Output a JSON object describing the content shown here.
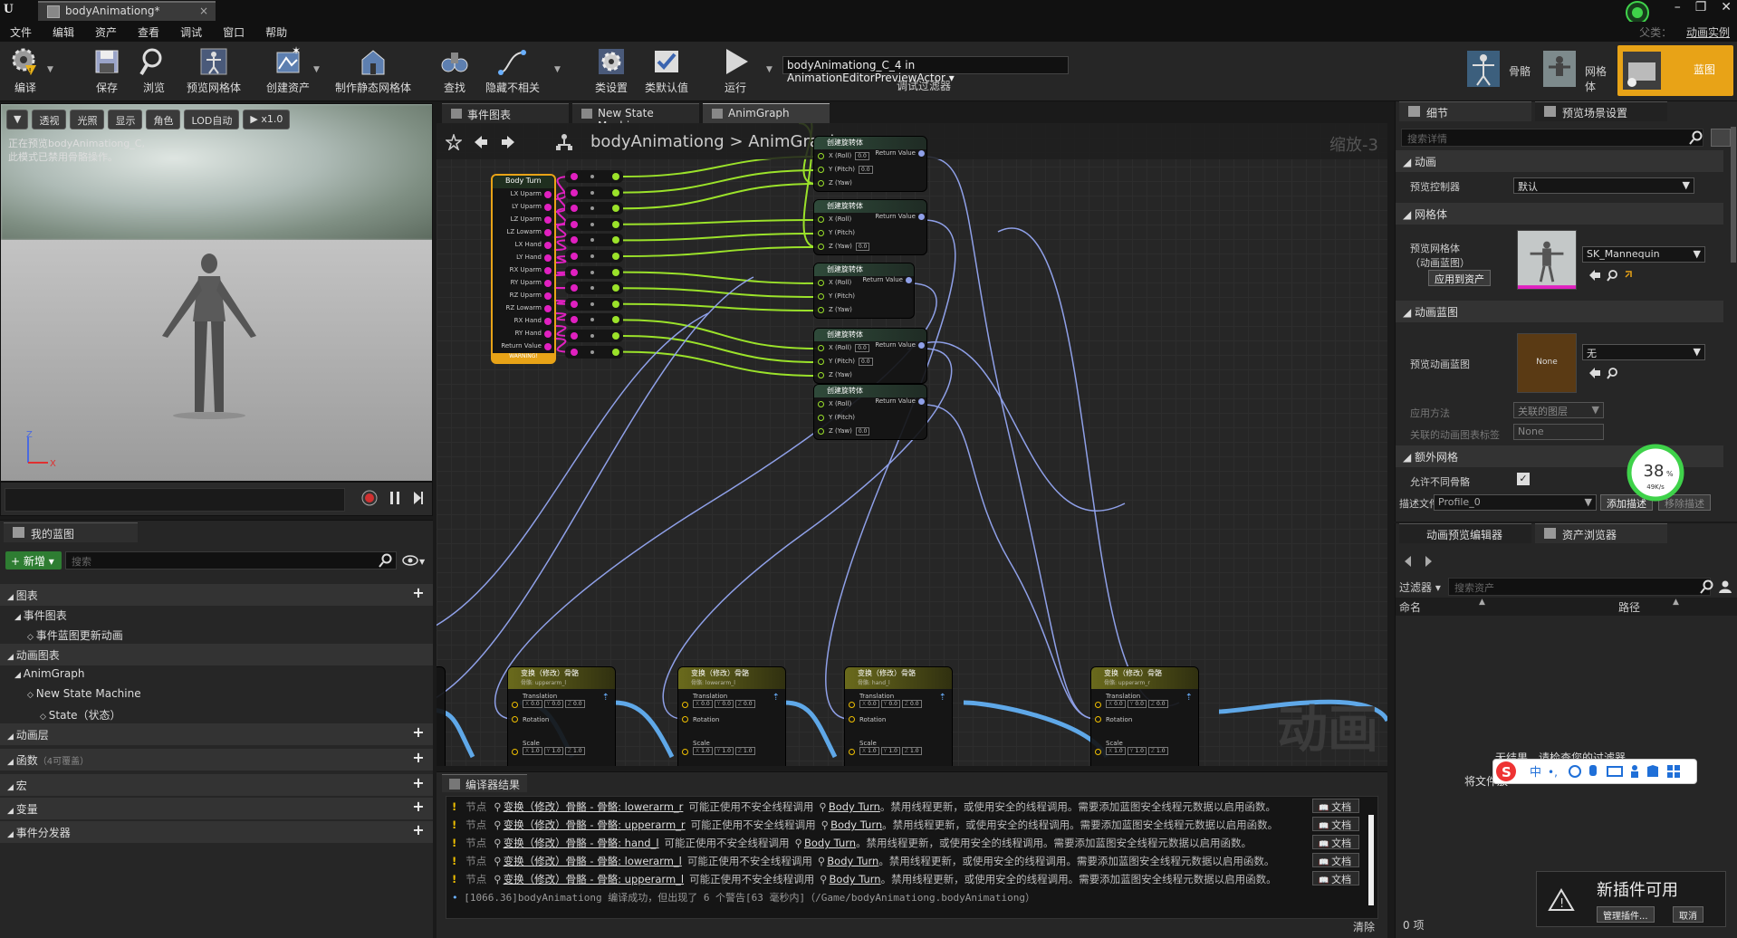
{
  "titlebar": {
    "tab_title": "bodyAnimationg*"
  },
  "menu": {
    "items": [
      "文件",
      "编辑",
      "资产",
      "查看",
      "调试",
      "窗口",
      "帮助"
    ],
    "parent_class_label": "父类：",
    "parent_class_value": "动画实例"
  },
  "toolbar": {
    "buttons": [
      "编译",
      "保存",
      "浏览",
      "预览网格体",
      "创建资产",
      "制作静态网格体",
      "查找",
      "隐藏不相关",
      "类设置",
      "类默认值",
      "运行"
    ],
    "debug_filter_value": "bodyAnimationg_C_4 in AnimationEditorPreviewActor",
    "debug_filter_label": "调试过滤器",
    "modes": [
      "骨骼",
      "网格体",
      "蓝图"
    ]
  },
  "viewport": {
    "buttons": [
      "透视",
      "光照",
      "显示",
      "角色",
      "LOD自动",
      "x1.0"
    ],
    "message_line1": "正在预览bodyAnimationg_C,",
    "message_line2": "此模式已禁用骨骼操作。"
  },
  "mybp": {
    "tab": "我的蓝图",
    "add_label": "+ 新增",
    "search_placeholder": "搜索",
    "rows": [
      {
        "label": "图表",
        "kind": "cat"
      },
      {
        "label": "事件图表",
        "kind": "item"
      },
      {
        "label": "事件蓝图更新动画",
        "kind": "item2"
      },
      {
        "label": "动画图表",
        "kind": "cat"
      },
      {
        "label": "AnimGraph",
        "kind": "item"
      },
      {
        "label": "New State Machine",
        "kind": "item2"
      },
      {
        "label": "State（状态）",
        "kind": "item3"
      },
      {
        "label": "动画层",
        "kind": "cat"
      },
      {
        "label": "函数",
        "sub": "（4可覆盖）",
        "kind": "cat"
      },
      {
        "label": "宏",
        "kind": "cat"
      },
      {
        "label": "变量",
        "kind": "cat"
      },
      {
        "label": "事件分发器",
        "kind": "cat"
      }
    ]
  },
  "graph": {
    "tabs": [
      "事件图表",
      "New State Machine",
      "AnimGraph"
    ],
    "crumb_root": "bodyAnimationg",
    "crumb_sep": ">",
    "crumb_leaf": "AnimGraph",
    "zoom": "缩放-3",
    "watermark": "动画",
    "body_turn": {
      "title": "Body Turn",
      "outputs": [
        "LX Uparm",
        "LY Uparm",
        "LZ Uparm",
        "LZ Lowarm",
        "LX Hand",
        "LY Hand",
        "RX Uparm",
        "RY Uparm",
        "RZ Uparm",
        "RZ Lowarm",
        "RX Hand",
        "RY Hand",
        "Return Value"
      ],
      "footer": "WARNING!"
    },
    "rot_title": "创建旋转体",
    "rot_pins": [
      "X (Roll)",
      "Y (Pitch)",
      "Z (Yaw)"
    ],
    "rot_return": "Return Value",
    "rot_default": "0.0",
    "bone_title": "变换（修改）骨骼",
    "bone_subs": [
      "骨骼: upperarm_l",
      "骨骼: lowerarm_l",
      "骨骼: hand_l",
      "骨骼: upperarm_r"
    ],
    "bone_pins": [
      "Translation",
      "Rotation",
      "Scale"
    ],
    "bone_axes": [
      "X",
      "Y",
      "Z"
    ],
    "bone_t": "0.0",
    "bone_s": "1.0"
  },
  "compiler": {
    "tab": "编译器结果",
    "rows": [
      {
        "lvl": "节点",
        "node": "变换（修改）骨骼 - 骨骼: lowerarm_r",
        "mid": "可能正使用不安全线程调用",
        "fn": "Body Turn",
        "tail": "。禁用线程更新，或使用安全的线程调用。需要添加蓝图安全线程元数据以启用函数。",
        "doc": "文档"
      },
      {
        "lvl": "节点",
        "node": "变换（修改）骨骼 - 骨骼: upperarm_r",
        "mid": "可能正使用不安全线程调用",
        "fn": "Body Turn",
        "tail": "。禁用线程更新，或使用安全的线程调用。需要添加蓝图安全线程元数据以启用函数。",
        "doc": "文档"
      },
      {
        "lvl": "节点",
        "node": "变换（修改）骨骼 - 骨骼: hand_l",
        "mid": "可能正使用不安全线程调用",
        "fn": "Body Turn",
        "tail": "。禁用线程更新，或使用安全的线程调用。需要添加蓝图安全线程元数据以启用函数。",
        "doc": "文档"
      },
      {
        "lvl": "节点",
        "node": "变换（修改）骨骼 - 骨骼: lowerarm_l",
        "mid": "可能正使用不安全线程调用",
        "fn": "Body Turn",
        "tail": "。禁用线程更新，或使用安全的线程调用。需要添加蓝图安全线程元数据以启用函数。",
        "doc": "文档"
      },
      {
        "lvl": "节点",
        "node": "变换（修改）骨骼 - 骨骼: upperarm_l",
        "mid": "可能正使用不安全线程调用",
        "fn": "Body Turn",
        "tail": "。禁用线程更新，或使用安全的线程调用。需要添加蓝图安全线程元数据以启用函数。",
        "doc": "文档"
      }
    ],
    "final": "[1066.36]bodyAnimationg 编译成功，但出现了 6 个警告[63 毫秒内]（/Game/bodyAnimationg.bodyAnimationg）",
    "clear": "清除"
  },
  "details": {
    "tab1": "细节",
    "tab2": "预览场景设置",
    "search_placeholder": "搜索详情",
    "cat_anim": "动画",
    "preview_controller_label": "预览控制器",
    "preview_controller_value": "默认",
    "cat_mesh": "网格体",
    "preview_mesh_label1": "预览网格体",
    "preview_mesh_label2": "（动画蓝图）",
    "preview_mesh_value": "SK_Mannequin",
    "apply_to_asset": "应用到资产",
    "cat_animbp": "动画蓝图",
    "preview_animbp_label": "预览动画蓝图",
    "preview_animbp_thumb": "None",
    "preview_animbp_value": "无",
    "apply_method_label": "应用方法",
    "apply_method_value": "关联的图层",
    "linked_tag_label": "关联的动画图表标签",
    "linked_tag_value": "None",
    "cat_extra": "额外网格",
    "allow_diff_bones": "允许不同骨骼",
    "desc_file_label": "描述文件",
    "desc_file_value": "Profile_0",
    "add_desc": "添加描述",
    "remove_desc": "移除描述",
    "perf_percent": "38",
    "perf_unit": "%",
    "perf_rate": "49K/s"
  },
  "assets": {
    "tab1": "动画预览编辑器",
    "tab2": "资产浏览器",
    "filter_label": "过滤器",
    "search_placeholder": "搜索资产",
    "col_name": "命名",
    "col_path": "路径",
    "no_results": "无结果，请检查您的过滤器。",
    "no_results2": "将文件放",
    "item_count": "0 项"
  },
  "popup": {
    "title": "新插件可用",
    "manage": "管理插件...",
    "cancel": "取消"
  },
  "colors": {
    "accent_orange": "#e8a317",
    "green_add": "#2e7d32",
    "pin_magenta": "#e020c0",
    "pin_green": "#9be22a",
    "wire_blue": "#8fa0e8"
  }
}
